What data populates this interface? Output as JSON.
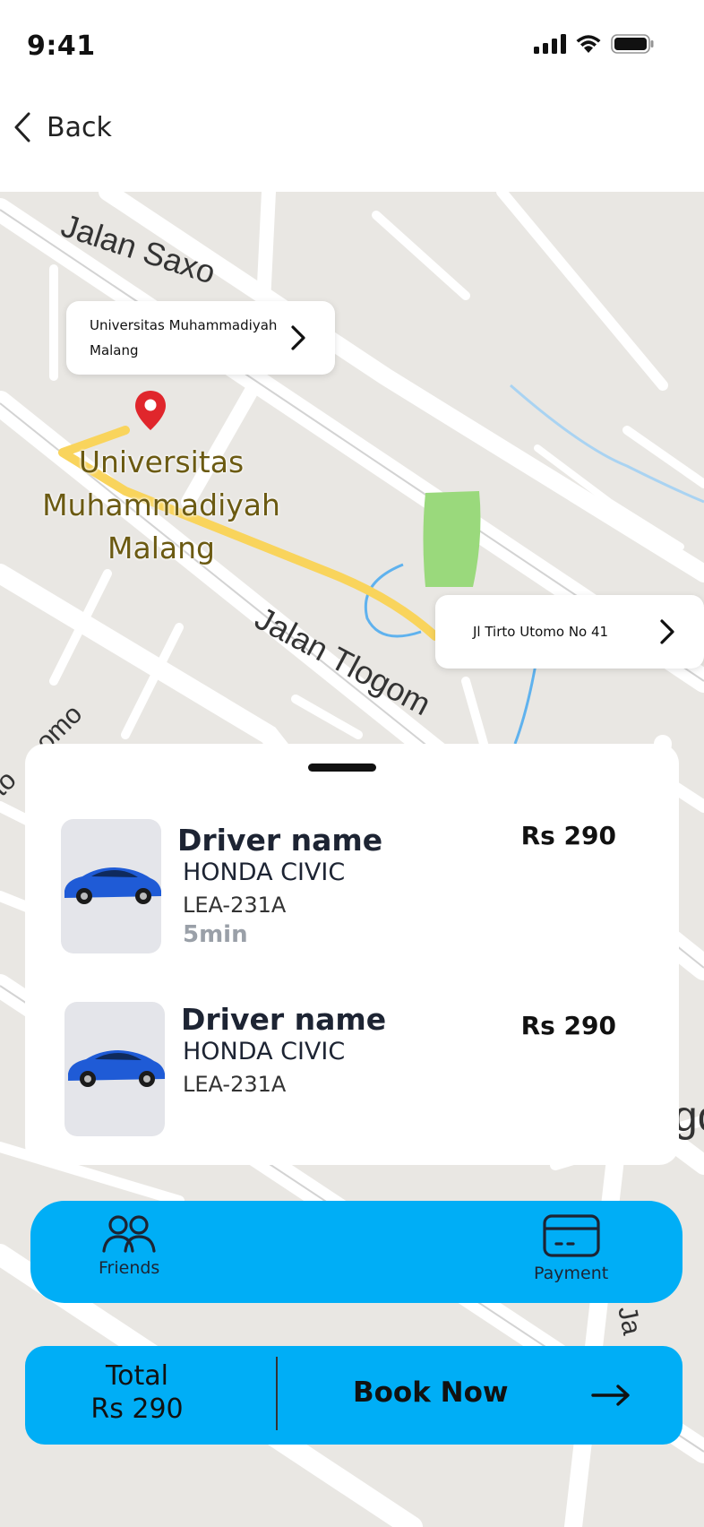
{
  "status_bar": {
    "time": "9:41"
  },
  "nav": {
    "back_label": "Back"
  },
  "map": {
    "origin_card": "Universitas Muhammadiyah Malang",
    "destination_card": "Jl Tirto Utomo No 41",
    "place_label": "Universitas Muhammadiyah Malang",
    "street_labels": [
      "Jalan Saxo",
      "Jalan Tlogom",
      "omo",
      "to",
      "go",
      "Ja"
    ]
  },
  "drivers": [
    {
      "name": "Driver name",
      "car": "HONDA CIVIC",
      "plate": "LEA-231A",
      "eta": "5min",
      "price": "Rs 290"
    },
    {
      "name": "Driver name",
      "car": "HONDA CIVIC",
      "plate": "LEA-231A",
      "price": "Rs 290"
    }
  ],
  "actions": {
    "friends_label": "Friends",
    "payment_label": "Payment"
  },
  "booking": {
    "total_label": "Total",
    "total_value": "Rs 290",
    "book_label": "Book Now"
  },
  "colors": {
    "accent": "#00aef6",
    "route": "#f9d45c",
    "pin": "#e0262c",
    "park": "#9ad97c"
  }
}
